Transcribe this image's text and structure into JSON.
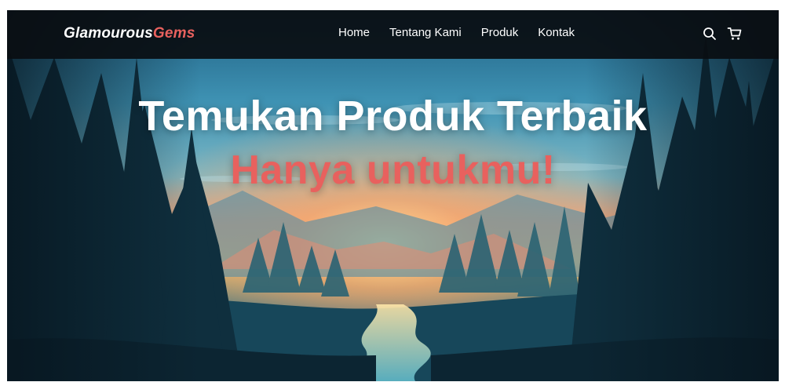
{
  "brand": {
    "part1": "Glamourous",
    "part2": "Gems"
  },
  "nav": {
    "items": [
      {
        "label": "Home"
      },
      {
        "label": "Tentang Kami"
      },
      {
        "label": "Produk"
      },
      {
        "label": "Kontak"
      }
    ],
    "icons": [
      "search-icon",
      "cart-icon"
    ]
  },
  "hero": {
    "headline": "Temukan Produk Terbaik",
    "subheadline": "Hanya untukmu!"
  },
  "colors": {
    "accent": "#e8615e",
    "navbar": "#0a0e12",
    "text": "#ffffff"
  }
}
